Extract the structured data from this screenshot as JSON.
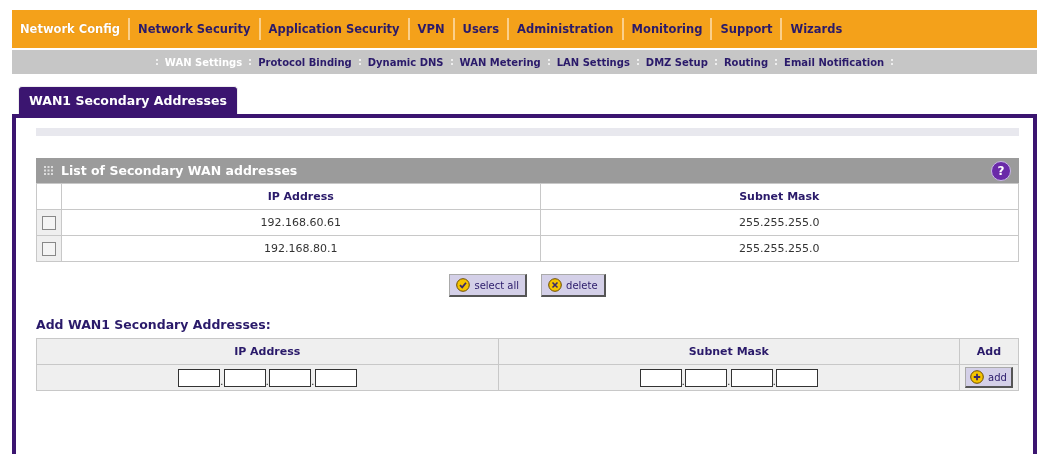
{
  "main_nav": [
    {
      "label": "Network Config",
      "selected": true
    },
    {
      "label": "Network Security",
      "selected": false
    },
    {
      "label": "Application Security",
      "selected": false
    },
    {
      "label": "VPN",
      "selected": false
    },
    {
      "label": "Users",
      "selected": false
    },
    {
      "label": "Administration",
      "selected": false
    },
    {
      "label": "Monitoring",
      "selected": false
    },
    {
      "label": "Support",
      "selected": false
    },
    {
      "label": "Wizards",
      "selected": false
    }
  ],
  "sub_nav": [
    {
      "label": "WAN Settings",
      "selected": true
    },
    {
      "label": "Protocol Binding",
      "selected": false
    },
    {
      "label": "Dynamic DNS",
      "selected": false
    },
    {
      "label": "WAN Metering",
      "selected": false
    },
    {
      "label": "LAN Settings",
      "selected": false
    },
    {
      "label": "DMZ Setup",
      "selected": false
    },
    {
      "label": "Routing",
      "selected": false
    },
    {
      "label": "Email Notification",
      "selected": false
    }
  ],
  "page_tab": "WAN1 Secondary Addresses",
  "list_section": {
    "title": "List of Secondary WAN addresses",
    "help_glyph": "?",
    "columns": [
      "IP Address",
      "Subnet Mask"
    ],
    "rows": [
      {
        "checked": false,
        "ip": "192.168.60.61",
        "mask": "255.255.255.0"
      },
      {
        "checked": false,
        "ip": "192.168.80.1",
        "mask": "255.255.255.0"
      }
    ],
    "buttons": [
      "select all",
      "delete"
    ]
  },
  "add_section": {
    "title": "Add WAN1 Secondary Addresses:",
    "columns": [
      "IP Address",
      "Subnet Mask",
      "Add"
    ],
    "octet_separator": ".",
    "add_button": "add"
  }
}
